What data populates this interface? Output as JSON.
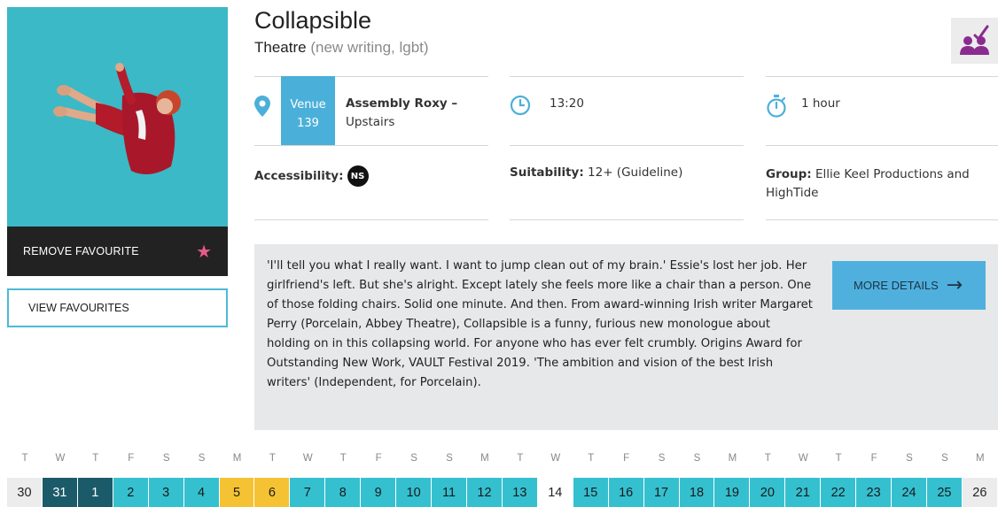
{
  "show": {
    "title": "Collapsible",
    "genre": "Theatre",
    "tags": "(new writing, lgbt)"
  },
  "favourites": {
    "remove_label": "REMOVE FAVOURITE",
    "view_label": "VIEW FAVOURITES"
  },
  "venue": {
    "label": "Venue",
    "number": "139",
    "name": "Assembly Roxy –",
    "room": "Upstairs"
  },
  "time": "13:20",
  "duration": "1 hour",
  "accessibility": {
    "label": "Accessibility:",
    "badge": "NS"
  },
  "suitability": {
    "label": "Suitability:",
    "value": "12+ (Guideline)"
  },
  "group": {
    "label": "Group:",
    "value": "Ellie Keel Productions and HighTide"
  },
  "description": "'I'll tell you what I really want. I want to jump clean out of my brain.' Essie's lost her job. Her girlfriend's left. But she's alright. Except lately she feels more like a chair than a person. One of those folding chairs. Solid one minute. And then. From award-winning Irish writer Margaret Perry (Porcelain, Abbey Theatre), Collapsible is a funny, furious new monologue about holding on in this collapsing world. For anyone who has ever felt crumbly. Origins Award for Outstanding New Work, VAULT Festival 2019. 'The ambition and vision of the best Irish writers' (Independent, for Porcelain).",
  "more_details_label": "MORE DETAILS",
  "colors": {
    "poster_bg": "#3bb9c6",
    "accent_blue": "#4fb0de",
    "selected_day": "#1b5b69",
    "available_day": "#35c0d0",
    "preview_day": "#f5c233",
    "favourite_star": "#e85a8c",
    "group_icon": "#8a2c8f"
  },
  "calendar": {
    "weekdays": [
      "T",
      "W",
      "T",
      "F",
      "S",
      "S",
      "M",
      "T",
      "W",
      "T",
      "F",
      "S",
      "S",
      "M",
      "T",
      "W",
      "T",
      "F",
      "S",
      "S",
      "M",
      "T",
      "W",
      "T",
      "F",
      "S",
      "S",
      "M"
    ],
    "days": [
      {
        "date": "30",
        "state": "grey"
      },
      {
        "date": "31",
        "state": "dark"
      },
      {
        "date": "1",
        "state": "dark"
      },
      {
        "date": "2",
        "state": "teal"
      },
      {
        "date": "3",
        "state": "teal"
      },
      {
        "date": "4",
        "state": "teal"
      },
      {
        "date": "5",
        "state": "yellow"
      },
      {
        "date": "6",
        "state": "yellow"
      },
      {
        "date": "7",
        "state": "teal"
      },
      {
        "date": "8",
        "state": "teal"
      },
      {
        "date": "9",
        "state": "teal"
      },
      {
        "date": "10",
        "state": "teal"
      },
      {
        "date": "11",
        "state": "teal"
      },
      {
        "date": "12",
        "state": "teal"
      },
      {
        "date": "13",
        "state": "teal"
      },
      {
        "date": "14",
        "state": "white"
      },
      {
        "date": "15",
        "state": "teal"
      },
      {
        "date": "16",
        "state": "teal"
      },
      {
        "date": "17",
        "state": "teal"
      },
      {
        "date": "18",
        "state": "teal"
      },
      {
        "date": "19",
        "state": "teal"
      },
      {
        "date": "20",
        "state": "teal"
      },
      {
        "date": "21",
        "state": "teal"
      },
      {
        "date": "22",
        "state": "teal"
      },
      {
        "date": "23",
        "state": "teal"
      },
      {
        "date": "24",
        "state": "teal"
      },
      {
        "date": "25",
        "state": "teal"
      },
      {
        "date": "26",
        "state": "grey"
      }
    ]
  }
}
